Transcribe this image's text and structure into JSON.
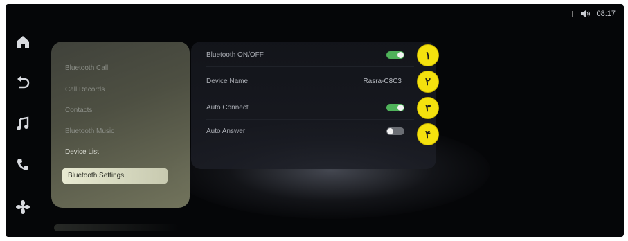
{
  "status_bar": {
    "time": "08:17"
  },
  "rail": {
    "icons": [
      "home-icon",
      "back-icon",
      "music-icon",
      "phone-icon",
      "fan-icon"
    ]
  },
  "submenu": {
    "items": [
      {
        "label": "Bluetooth Call"
      },
      {
        "label": "Call Records"
      },
      {
        "label": "Contacts"
      },
      {
        "label": "Bluetooth Music"
      },
      {
        "label": "Device List"
      },
      {
        "label": "Bluetooth Settings"
      }
    ],
    "selected_index": 5
  },
  "settings": {
    "rows": [
      {
        "label": "Bluetooth ON/OFF",
        "type": "toggle",
        "state": "on"
      },
      {
        "label": "Device Name",
        "type": "value",
        "value": "Rasra-C8C3"
      },
      {
        "label": "Auto Connect",
        "type": "toggle",
        "state": "on"
      },
      {
        "label": "Auto Answer",
        "type": "toggle",
        "state": "off"
      }
    ]
  },
  "markers": [
    "۱",
    "۲",
    "۳",
    "۴"
  ],
  "colors": {
    "toggle_on": "#4fb25a",
    "toggle_off": "#6b6e74",
    "marker": "#f4e10e"
  }
}
